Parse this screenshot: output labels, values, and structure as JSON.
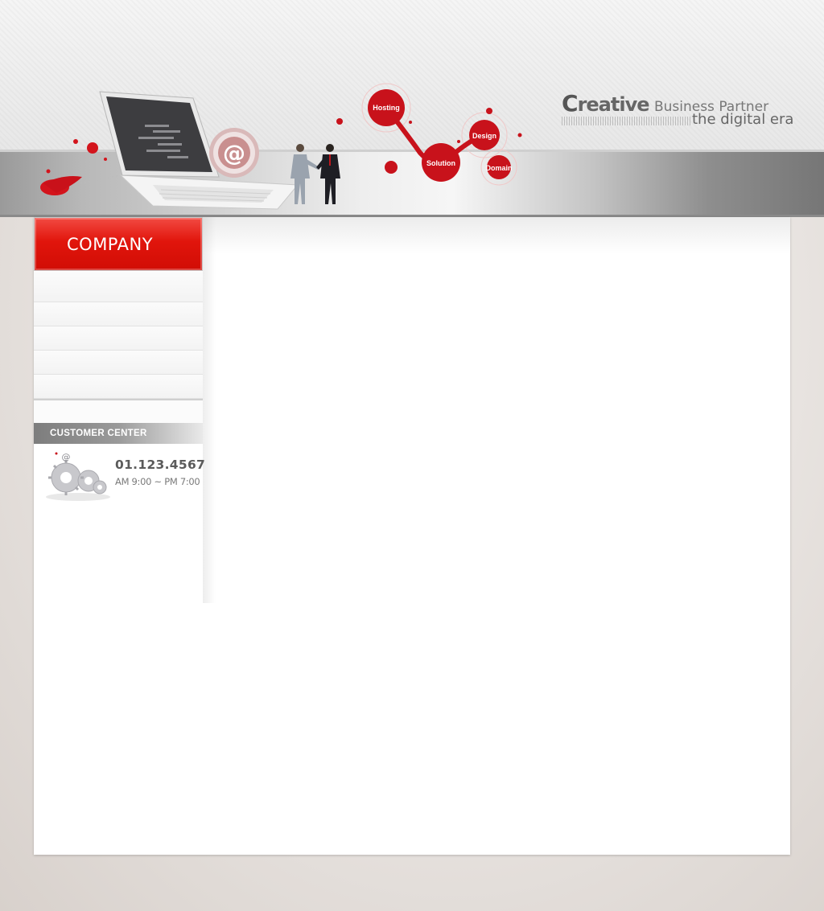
{
  "header": {
    "blobs": {
      "hosting": "Hosting",
      "design": "Design",
      "solution": "Solution",
      "domain": "Domain"
    },
    "slogan": {
      "first_letter": "C",
      "word": "reative",
      "rest": "Business Partner",
      "line2": "the digital era"
    },
    "accent_color": "#e1150c"
  },
  "sidebar": {
    "section_title": "COMPANY",
    "menu_items": [
      "",
      "",
      "",
      "",
      ""
    ],
    "customer_center": {
      "title": "CUSTOMER CENTER",
      "phone": "01.123.4567",
      "hours": "AM 9:00 ~ PM 7:00",
      "icon": "gears-icon"
    }
  }
}
